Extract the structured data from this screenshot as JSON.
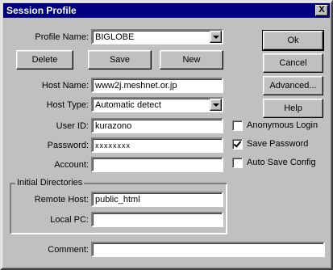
{
  "window": {
    "title": "Session Profile",
    "close_glyph": "X"
  },
  "profile": {
    "label": "Profile Name:",
    "value": "BIGLOBE"
  },
  "buttons": {
    "delete": "Delete",
    "save": "Save",
    "new": "New",
    "ok": "Ok",
    "cancel": "Cancel",
    "advanced": "Advanced...",
    "help": "Help"
  },
  "fields": {
    "host_name": {
      "label": "Host Name:",
      "value": "www2j.meshnet.or.jp"
    },
    "host_type": {
      "label": "Host Type:",
      "value": "Automatic detect"
    },
    "user_id": {
      "label": "User ID:",
      "value": "kurazono"
    },
    "password": {
      "label": "Password:",
      "value": "xxxxxxxx"
    },
    "account": {
      "label": "Account:",
      "value": ""
    },
    "comment": {
      "label": "Comment:",
      "value": ""
    }
  },
  "checkboxes": {
    "anonymous_login": {
      "label": "Anonymous Login",
      "checked": false
    },
    "save_password": {
      "label": "Save Password",
      "checked": true
    },
    "auto_save_config": {
      "label": "Auto Save Config",
      "checked": false
    }
  },
  "initial_directories": {
    "title": "Initial Directories",
    "remote_host": {
      "label": "Remote Host:",
      "value": "public_html"
    },
    "local_pc": {
      "label": "Local PC:",
      "value": ""
    }
  },
  "icons": {
    "close": "close-icon",
    "dropdown": "chevron-down-icon",
    "check": "check-icon"
  }
}
